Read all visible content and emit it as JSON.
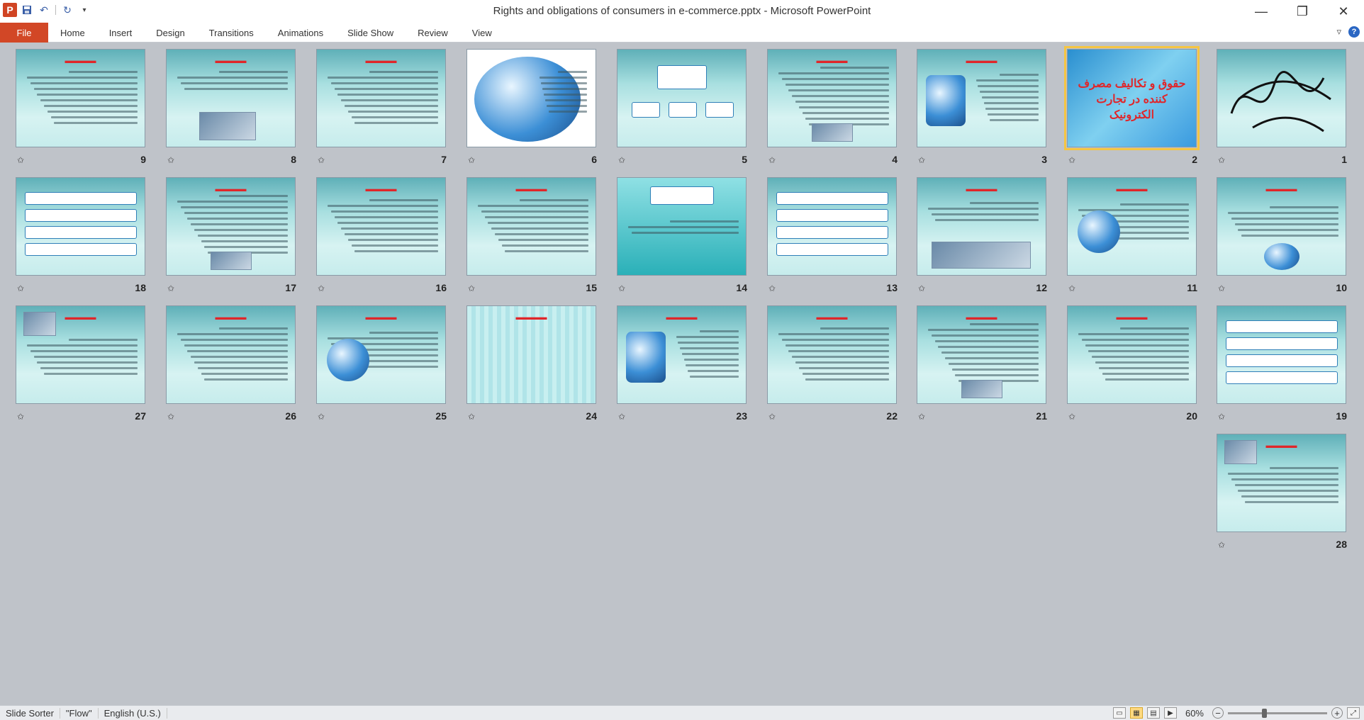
{
  "window": {
    "title": "Rights and obligations of consumers in e-commerce.pptx  -  Microsoft PowerPoint",
    "logo_letter": "P",
    "minimize": "—",
    "restore": "❐",
    "close": "✕"
  },
  "ribbon": {
    "file_tab": "File",
    "tabs": [
      "Home",
      "Insert",
      "Design",
      "Transitions",
      "Animations",
      "Slide Show",
      "Review",
      "View"
    ]
  },
  "slides": [
    {
      "number": "1"
    },
    {
      "number": "2",
      "title": "حقوق و تکالیف مصرف کننده در تجارت الکترونیک"
    },
    {
      "number": "3"
    },
    {
      "number": "4"
    },
    {
      "number": "5"
    },
    {
      "number": "6"
    },
    {
      "number": "7"
    },
    {
      "number": "8"
    },
    {
      "number": "9"
    },
    {
      "number": "10"
    },
    {
      "number": "11"
    },
    {
      "number": "12"
    },
    {
      "number": "13"
    },
    {
      "number": "14"
    },
    {
      "number": "15"
    },
    {
      "number": "16"
    },
    {
      "number": "17"
    },
    {
      "number": "18"
    },
    {
      "number": "19"
    },
    {
      "number": "20"
    },
    {
      "number": "21"
    },
    {
      "number": "22"
    },
    {
      "number": "23"
    },
    {
      "number": "24"
    },
    {
      "number": "25"
    },
    {
      "number": "26"
    },
    {
      "number": "27"
    },
    {
      "number": "28"
    }
  ],
  "selected_slide": "2",
  "statusbar": {
    "view": "Slide Sorter",
    "theme": "\"Flow\"",
    "language": "English (U.S.)",
    "zoom": "60%"
  }
}
